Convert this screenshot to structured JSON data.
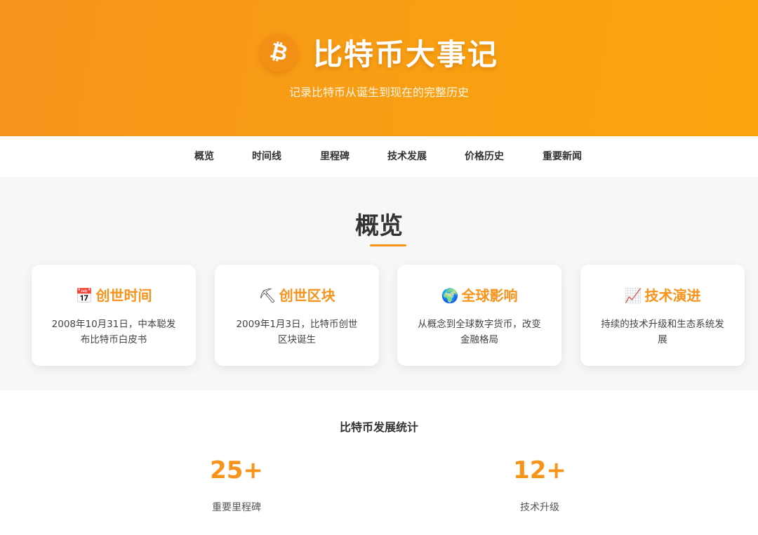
{
  "header": {
    "logo_icon": "bitcoin-icon",
    "logo_glyph": "₿",
    "title": "比特币大事记",
    "subtitle": "记录比特币从诞生到现在的完整历史",
    "colors": {
      "accent": "#f7931a",
      "header_bg": "#fba30e",
      "text_on_accent": "#ffffff"
    }
  },
  "nav": {
    "items": [
      {
        "label": "概览"
      },
      {
        "label": "时间线"
      },
      {
        "label": "里程碑"
      },
      {
        "label": "技术发展"
      },
      {
        "label": "价格历史"
      },
      {
        "label": "重要新闻"
      }
    ]
  },
  "overview": {
    "title": "概览",
    "cards": [
      {
        "icon": "calendar-icon",
        "emoji": "📅",
        "title": "创世时间",
        "desc": "2008年10月31日，中本聪发布比特币白皮书"
      },
      {
        "icon": "pickaxe-icon",
        "emoji": "⛏",
        "title": "创世区块",
        "desc": "2009年1月3日，比特币创世区块诞生"
      },
      {
        "icon": "globe-icon",
        "emoji": "🌍",
        "title": "全球影响",
        "desc": "从概念到全球数字货币，改变金融格局"
      },
      {
        "icon": "chart-increasing-icon",
        "emoji": "📈",
        "title": "技术演进",
        "desc": "持续的技术升级和生态系统发展"
      }
    ]
  },
  "stats": {
    "title": "比特币发展统计",
    "items": [
      {
        "number": "25+",
        "label": "重要里程碑"
      },
      {
        "number": "12+",
        "label": "技术升级"
      }
    ]
  }
}
